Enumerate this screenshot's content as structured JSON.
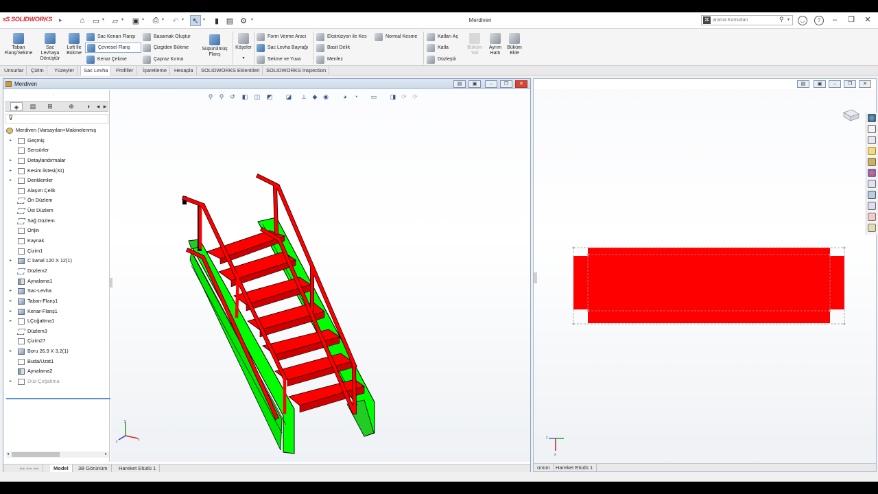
{
  "app": {
    "logo_text": "SOLIDWORKS",
    "document_title": "Merdiven",
    "search_placeholder": "arama Komutları"
  },
  "ribbon": {
    "big_buttons": [
      {
        "label": "Taban\nFlanş/Sekme",
        "icon": "base-flange-icon"
      },
      {
        "label": "Sac\nLevhaya\nDönüştür",
        "icon": "convert-to-sheet-metal-icon"
      },
      {
        "label": "Loft İle\nBükme",
        "icon": "lofted-bend-icon"
      },
      {
        "label": "Süpürülmüş\nFlanş",
        "icon": "swept-flange-icon"
      },
      {
        "label": "Köşeler",
        "icon": "corners-icon"
      },
      {
        "label": "Büküm\nYok",
        "icon": "no-bends-icon",
        "disabled": true
      },
      {
        "label": "Ayrım\nHattı",
        "icon": "rip-icon"
      },
      {
        "label": "Büküm\nEkle",
        "icon": "insert-bends-icon"
      }
    ],
    "small_buttons": {
      "col1": [
        "Sac Kenarı Flanşı",
        "Çevresel Flanş",
        "Kenar Çekme"
      ],
      "col2": [
        "Basamak Oluştur",
        "Çizgiden Bükme",
        "Çapraz Kırma"
      ],
      "col3": [
        "Form Verme Aracı",
        "Sac Levha Bayrağı",
        "Sekme ve Yuva"
      ],
      "col4": [
        "Ekstrüzyon ile Kes",
        "Basit Delik",
        "Menfez"
      ],
      "col5": [
        "Normal Kesme"
      ],
      "col6": [
        "Katları Aç",
        "Katla",
        "Düzleştir"
      ]
    }
  },
  "command_tabs": [
    "Unsurlar",
    "Çizim",
    "Yüzeyler",
    "Sac Levha",
    "Profiller",
    "İşaretleme",
    "Hesapla",
    "SOLIDWORKS Eklentileri",
    "SOLIDWORKS Inspection"
  ],
  "active_tab": "Sac Levha",
  "doc_window": {
    "title": "Merdiven"
  },
  "feature_tree": {
    "root": "Merdiven  (Varsayılan<Makinelenmiş",
    "items": [
      {
        "label": "Geçmiş",
        "expand": true,
        "icon": "history-icon"
      },
      {
        "label": "Sensörler",
        "expand": false,
        "icon": "sensors-icon"
      },
      {
        "label": "Detaylandırmalar",
        "expand": true,
        "icon": "annotations-icon"
      },
      {
        "label": "Kesim listesi(31)",
        "expand": true,
        "icon": "cut-list-icon"
      },
      {
        "label": "Denklemler",
        "expand": true,
        "icon": "equations-icon"
      },
      {
        "label": "Alaşım Çelik",
        "expand": false,
        "icon": "material-icon"
      },
      {
        "label": "Ön Düzlem",
        "expand": false,
        "icon": "plane-icon"
      },
      {
        "label": "Üst Düzlem",
        "expand": false,
        "icon": "plane-icon"
      },
      {
        "label": "Sağ Düzlem",
        "expand": false,
        "icon": "plane-icon"
      },
      {
        "label": "Orijin",
        "expand": false,
        "icon": "origin-icon"
      },
      {
        "label": "Kaynak",
        "expand": false,
        "icon": "weld-icon"
      },
      {
        "label": "Çizim1",
        "expand": false,
        "icon": "sketch-icon"
      },
      {
        "label": "C kanal 120 X 12(1)",
        "expand": true,
        "icon": "structural-member-icon"
      },
      {
        "label": "Düzlem2",
        "expand": false,
        "icon": "plane-icon"
      },
      {
        "label": "Aynalama1",
        "expand": false,
        "icon": "mirror-icon"
      },
      {
        "label": "Sac-Levha",
        "expand": true,
        "icon": "sheet-metal-icon"
      },
      {
        "label": "Taban-Flanş1",
        "expand": true,
        "icon": "base-flange-icon"
      },
      {
        "label": "Kenar-Flanş1",
        "expand": true,
        "icon": "edge-flange-icon"
      },
      {
        "label": "LÇoğaltma1",
        "expand": true,
        "icon": "linear-pattern-icon"
      },
      {
        "label": "Düzlem3",
        "expand": false,
        "icon": "plane-icon"
      },
      {
        "label": "Çizim27",
        "expand": false,
        "icon": "sketch-icon"
      },
      {
        "label": "Boru 26.9 X 3.2(1)",
        "expand": true,
        "icon": "structural-member-icon"
      },
      {
        "label": "Buda/Uzat1",
        "expand": false,
        "icon": "trim-extend-icon"
      },
      {
        "label": "Aynalama2",
        "expand": false,
        "icon": "mirror-icon"
      },
      {
        "label": "Düz-Çoğaltma",
        "expand": true,
        "icon": "flat-pattern-icon",
        "dim": true
      }
    ]
  },
  "bottom_tabs": [
    "Model",
    "3B Görünüm",
    "Hareket Etüdü 1"
  ],
  "right_bottom_tabs": [
    "ünüm",
    "Hareket Etüdü 1"
  ],
  "colors": {
    "handrail": "#ff0000",
    "stringer": "#00ff00",
    "flat_pattern": "#ff0000",
    "accent": "#5a8fd0"
  }
}
